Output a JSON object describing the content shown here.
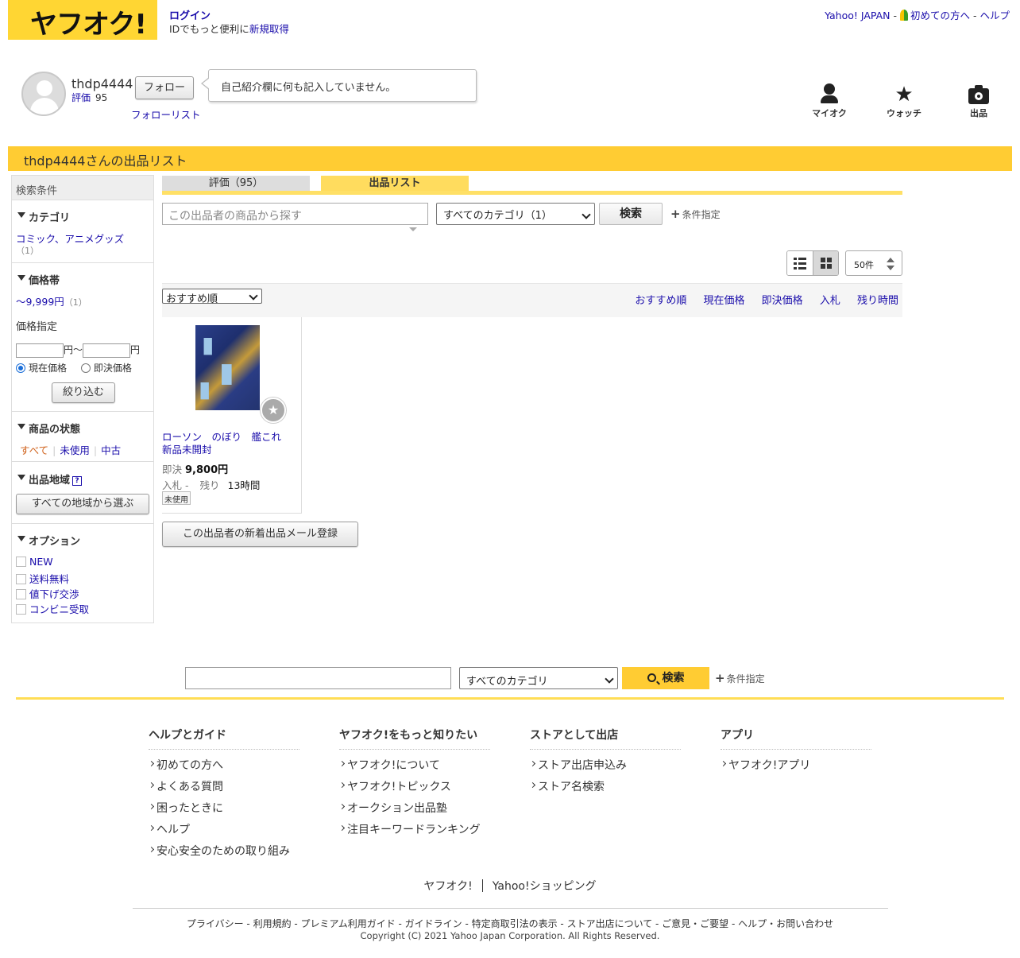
{
  "header": {
    "logo_text": "ヤフオク!",
    "login": "ログイン",
    "id_text": "IDでもっと便利に",
    "signup_link": "新規取得",
    "yahoo_japan": "Yahoo! JAPAN",
    "first_time": "初めての方へ",
    "help": "ヘルプ",
    "sep": " - "
  },
  "profile": {
    "username": "thdp4444",
    "rating_label": "評価",
    "rating_value": "95",
    "follow_button": "フォロー",
    "follow_list": "フォローリスト",
    "bio": "自己紹介欄に何も記入していません。"
  },
  "icon_menu": {
    "myauc": "マイオク",
    "watch": "ウォッチ",
    "sell": "出品"
  },
  "page_title": "thdp4444さんの出品リスト",
  "sidebar": {
    "header": "検索条件",
    "category": {
      "title": "カテゴリ",
      "link": "コミック、アニメグッズ",
      "count": "（1）"
    },
    "price": {
      "title": "価格帯",
      "range_link": "〜9,999円",
      "range_count": "（1）",
      "spec_label": "価格指定",
      "yen": "円",
      "yen_tilde": "円～",
      "radio_current": "現在価格",
      "radio_buynow": "即決価格",
      "filter_button": "絞り込む"
    },
    "condition": {
      "title": "商品の状態",
      "all": "すべて",
      "unused": "未使用",
      "used": "中古"
    },
    "region": {
      "title": "出品地域",
      "help_mark": "?",
      "button": "すべての地域から選ぶ"
    },
    "options": {
      "title": "オプション",
      "items": [
        "NEW",
        "送料無料",
        "値下げ交渉",
        "コンビニ受取"
      ]
    }
  },
  "tabs": {
    "evaluation": "評価（95）",
    "listing": "出品リスト"
  },
  "search": {
    "placeholder": "この出品者の商品から探す",
    "category_selected": "すべてのカテゴリ（1）",
    "button": "検索",
    "condition": "条件指定"
  },
  "view": {
    "per_page": "50件"
  },
  "sort": {
    "selected": "おすすめ順",
    "links": [
      "おすすめ順",
      "現在価格",
      "即決価格",
      "入札",
      "残り時間"
    ]
  },
  "item": {
    "title": "ローソン　のぼり　艦これ　新品未開封",
    "price_label": "即決",
    "price": "9,800円",
    "bid_label": "入札",
    "bid_value": "-",
    "remain_label": "残り",
    "remain_value": "13時間",
    "badge": "未使用"
  },
  "mail_button": "この出品者の新着出品メール登録",
  "footer_search": {
    "category_selected": "すべてのカテゴリ",
    "button": "検索",
    "condition": "条件指定"
  },
  "footer_cols": [
    {
      "title": "ヘルプとガイド",
      "items": [
        "初めての方へ",
        "よくある質問",
        "困ったときに",
        "ヘルプ",
        "安心安全のための取り組み"
      ]
    },
    {
      "title": "ヤフオク!をもっと知りたい",
      "items": [
        "ヤフオク!について",
        "ヤフオク!トピックス",
        "オークション出品塾",
        "注目キーワードランキング"
      ]
    },
    {
      "title": "ストアとして出店",
      "items": [
        "ストア出店申込み",
        "ストア名検索"
      ]
    },
    {
      "title": "アプリ",
      "items": [
        "ヤフオク!アプリ"
      ]
    }
  ],
  "brand_links": [
    "ヤフオク!",
    "Yahoo!ショッピング"
  ],
  "legal": "プライバシー - 利用規約 - プレミアム利用ガイド - ガイドライン - 特定商取引法の表示 - ストア出店について - ご意見・ご要望 - ヘルプ・お問い合わせ",
  "copyright": "Copyright (C) 2021 Yahoo Japan Corporation. All Rights Reserved.",
  "colors": {
    "brand_yellow": "#ffcc33",
    "link_blue": "#1a0dab"
  }
}
